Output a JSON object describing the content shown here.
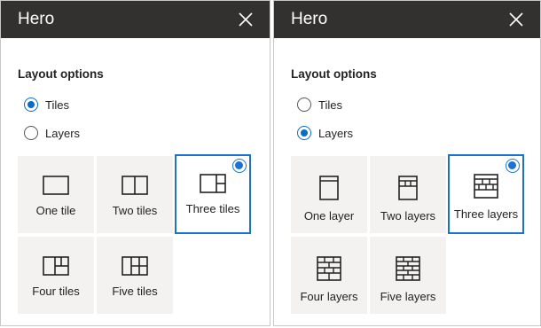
{
  "left_panel": {
    "title": "Hero",
    "section_label": "Layout options",
    "radio_options": [
      {
        "label": "Tiles",
        "checked": true
      },
      {
        "label": "Layers",
        "checked": false
      }
    ],
    "tiles": [
      {
        "label": "One tile",
        "icon": "one-tile-icon"
      },
      {
        "label": "Two tiles",
        "icon": "two-tiles-icon"
      },
      {
        "label": "Three tiles",
        "icon": "three-tiles-icon",
        "selected": true
      },
      {
        "label": "Four tiles",
        "icon": "four-tiles-icon"
      },
      {
        "label": "Five tiles",
        "icon": "five-tiles-icon"
      }
    ]
  },
  "right_panel": {
    "title": "Hero",
    "section_label": "Layout options",
    "radio_options": [
      {
        "label": "Tiles",
        "checked": false
      },
      {
        "label": "Layers",
        "checked": true
      }
    ],
    "tiles": [
      {
        "label": "One layer",
        "icon": "one-layer-icon"
      },
      {
        "label": "Two layers",
        "icon": "two-layers-icon"
      },
      {
        "label": "Three layers",
        "icon": "three-layers-icon",
        "selected": true
      },
      {
        "label": "Four layers",
        "icon": "four-layers-icon"
      },
      {
        "label": "Five layers",
        "icon": "five-layers-icon"
      }
    ]
  },
  "colors": {
    "header_bg": "#323130",
    "accent": "#1a73d4",
    "tile_bg": "#f3f2f1"
  }
}
